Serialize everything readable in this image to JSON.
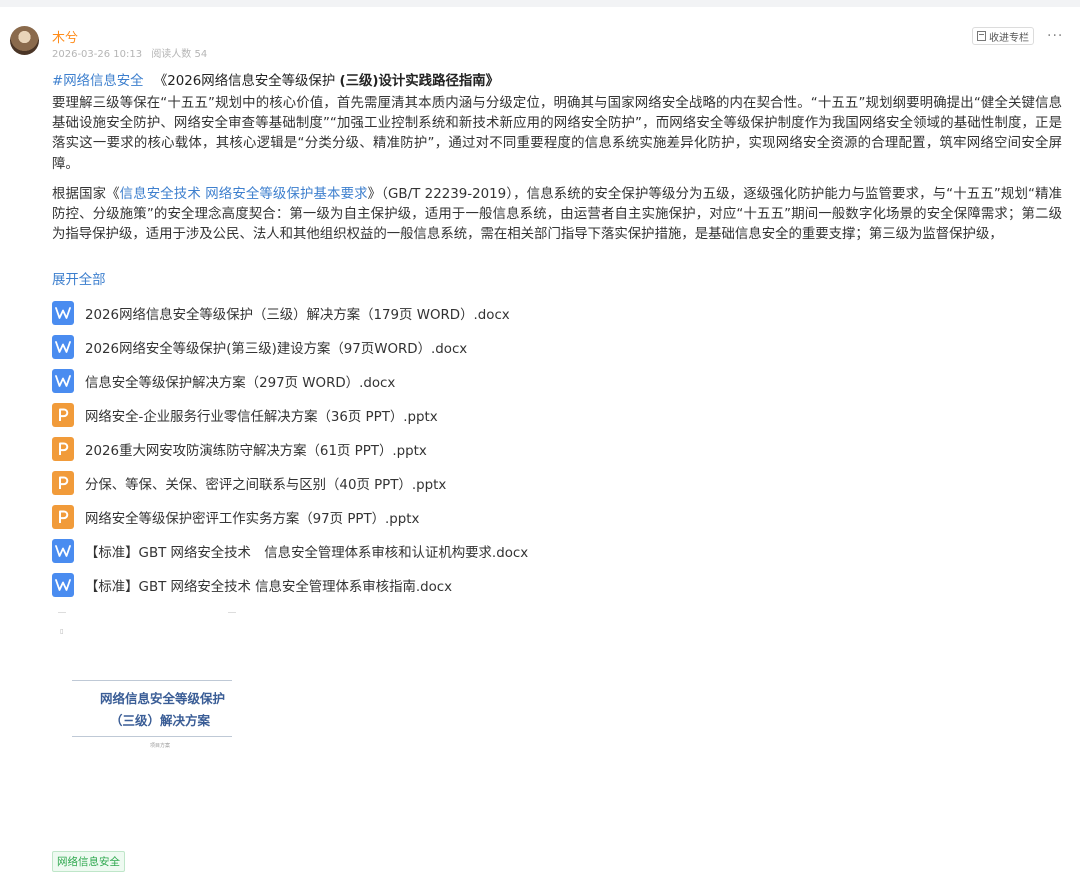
{
  "author": {
    "name": "木兮",
    "date": "2026-03-26 10:13",
    "views": "阅读人数 54"
  },
  "actions": {
    "subscribe_label": "收进专栏",
    "more_label": "···"
  },
  "post": {
    "hashtag": "#网络信息安全",
    "title_plain": "《2026网络信息安全等级保护 ",
    "title_bold": "(三级)设计实践路径指南》",
    "para1": "要理解三级等保在“十五五”规划中的核心价值，首先需厘清其本质内涵与分级定位，明确其与国家网络安全战略的内在契合性。“十五五”规划纲要明确提出“健全关键信息基础设施安全防护、网络安全审查等基础制度”“加强工业控制系统和新技术新应用的网络安全防护”，而网络安全等级保护制度作为我国网络安全领域的基础性制度，正是落实这一要求的核心载体，其核心逻辑是“分类分级、精准防护”，通过对不同重要程度的信息系统实施差异化防护，实现网络安全资源的合理配置，筑牢网络空间安全屏障。",
    "para2_prefix": "根据国家《",
    "para2_link": "信息安全技术 网络安全等级保护基本要求",
    "para2_rest": "》（GB/T 22239-2019），信息系统的安全保护等级分为五级，逐级强化防护能力与监管要求，与“十五五”规划“精准防控、分级施策”的安全理念高度契合：第一级为自主保护级，适用于一般信息系统，由运营者自主实施保护，对应“十五五”期间一般数字化场景的安全保障需求；第二级为指导保护级，适用于涉及公民、法人和其他组织权益的一般信息系统，需在相关部门指导下落实保护措施，是基础信息安全的重要支撑；第三级为监督保护级，",
    "expand_label": "展开全部"
  },
  "files": [
    {
      "type": "word",
      "icon": "word-file-icon",
      "name": "2026网络信息安全等级保护（三级）解决方案（179页 WORD）.docx"
    },
    {
      "type": "word",
      "icon": "word-file-icon",
      "name": "2026网络安全等级保护(第三级)建设方案（97页WORD）.docx"
    },
    {
      "type": "word",
      "icon": "word-file-icon",
      "name": "信息安全等级保护解决方案（297页 WORD）.docx"
    },
    {
      "type": "ppt",
      "icon": "ppt-file-icon",
      "name": "网络安全-企业服务行业零信任解决方案（36页 PPT）.pptx"
    },
    {
      "type": "ppt",
      "icon": "ppt-file-icon",
      "name": "2026重大网安攻防演练防守解决方案（61页 PPT）.pptx"
    },
    {
      "type": "ppt",
      "icon": "ppt-file-icon",
      "name": "分保、等保、关保、密评之间联系与区别（40页 PPT）.pptx"
    },
    {
      "type": "ppt",
      "icon": "ppt-file-icon",
      "name": "网络安全等级保护密评工作实务方案（97页 PPT）.pptx"
    },
    {
      "type": "word",
      "icon": "word-file-icon",
      "name": "【标准】GBT 网络安全技术　信息安全管理体系审核和认证机构要求.docx"
    },
    {
      "type": "word",
      "icon": "word-file-icon",
      "name": "【标准】GBT 网络安全技术 信息安全管理体系审核指南.docx"
    }
  ],
  "thumbnail": {
    "title_line1": "网络信息安全等级保护",
    "title_line2": "（三级）解决方案",
    "subtitle": "项目方案"
  },
  "tag": "网络信息安全",
  "colors": {
    "accent_link": "#3d7fce",
    "author": "#ff8c1a",
    "word_icon": "#4a8cf0",
    "ppt_icon": "#f19b3a",
    "tag_green": "#2fa84f"
  }
}
